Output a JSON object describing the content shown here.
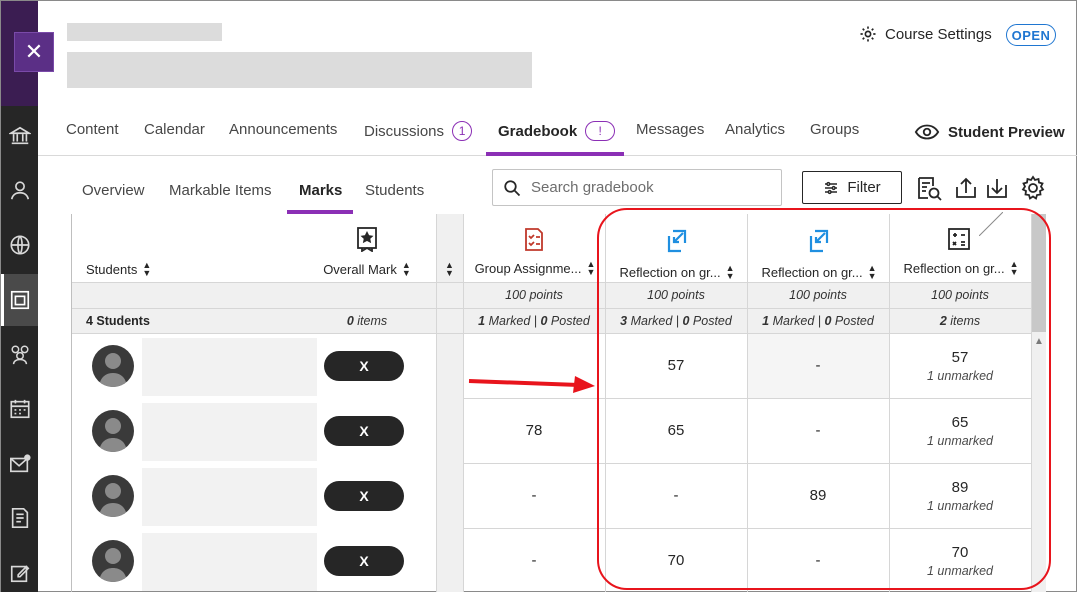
{
  "header": {
    "course_settings_label": "Course Settings",
    "status_badge": "OPEN",
    "close_symbol": "✕"
  },
  "main_tabs": [
    {
      "label": "Content"
    },
    {
      "label": "Calendar"
    },
    {
      "label": "Announcements"
    },
    {
      "label": "Discussions",
      "badge": "1"
    },
    {
      "label": "Gradebook",
      "badge": "!",
      "active": true
    },
    {
      "label": "Messages"
    },
    {
      "label": "Analytics"
    },
    {
      "label": "Groups"
    }
  ],
  "student_preview_label": "Student Preview",
  "sub_tabs": [
    {
      "label": "Overview"
    },
    {
      "label": "Markable Items"
    },
    {
      "label": "Marks",
      "active": true
    },
    {
      "label": "Students"
    }
  ],
  "search": {
    "placeholder": "Search gradebook"
  },
  "filter_label": "Filter",
  "grid": {
    "columns": {
      "students": "Students",
      "overall": "Overall Mark",
      "group_assignment": "Group Assignme...",
      "reflection1": "Reflection on gr...",
      "reflection2": "Reflection on gr...",
      "reflection3": "Reflection on gr..."
    },
    "points": {
      "group_assignment": "100 points",
      "reflection1": "100 points",
      "reflection2": "100 points",
      "reflection3": "100 points"
    },
    "stats": {
      "students_count": "4 Students",
      "overall_items_num": "0",
      "overall_items_word": " items",
      "group_marked_num": "1",
      "group_marked_word": " Marked | ",
      "group_posted_num": "0",
      "group_posted_word": " Posted",
      "r1_marked_num": "3",
      "r1_marked_word": " Marked | ",
      "r1_posted_num": "0",
      "r1_posted_word": " Posted",
      "r2_marked_num": "1",
      "r2_marked_word": " Marked | ",
      "r2_posted_num": "0",
      "r2_posted_word": " Posted",
      "r3_items_num": "2",
      "r3_items_word": " items"
    },
    "rows": [
      {
        "overall": "X",
        "group": "",
        "r1": "57",
        "r2": "-",
        "r3": "57",
        "r3_sub": "1 unmarked"
      },
      {
        "overall": "X",
        "group": "78",
        "r1": "65",
        "r2": "-",
        "r3": "65",
        "r3_sub": "1 unmarked"
      },
      {
        "overall": "X",
        "group": "-",
        "r1": "-",
        "r2": "89",
        "r3": "89",
        "r3_sub": "1 unmarked"
      },
      {
        "overall": "X",
        "group": "-",
        "r1": "70",
        "r2": "-",
        "r3": "70",
        "r3_sub": "1 unmarked"
      }
    ]
  },
  "colors": {
    "accent_purple": "#8b2fb5",
    "link_blue": "#1f76d1",
    "annotation_red": "#e8141c",
    "sidebar_bg": "#262626"
  },
  "icons": {
    "sidebar": [
      "institution-icon",
      "profile-icon",
      "globe-icon",
      "courses-icon",
      "groups-icon",
      "calendar-icon",
      "messages-icon",
      "grades-icon",
      "tools-icon"
    ],
    "toolbar": [
      "grading-queue-icon",
      "export-icon",
      "import-icon",
      "settings-gear-icon"
    ]
  }
}
